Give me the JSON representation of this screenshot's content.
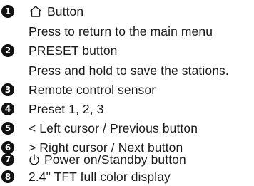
{
  "items": [
    {
      "number": "1",
      "label": "Button",
      "icon": "home-icon",
      "description": "Press to return to the main menu"
    },
    {
      "number": "2",
      "label": "PRESET button",
      "description": "Press and hold to save the stations."
    },
    {
      "number": "3",
      "label": "Remote control sensor"
    },
    {
      "number": "4",
      "label": "Preset 1, 2, 3"
    },
    {
      "number": "5",
      "label": "< Left cursor / Previous button"
    },
    {
      "number": "6",
      "label": "> Right cursor / Next button"
    },
    {
      "number": "7",
      "label": "Power on/Standby button",
      "icon": "power-icon"
    },
    {
      "number": "8",
      "label": "2.4\" TFT full color display"
    }
  ]
}
